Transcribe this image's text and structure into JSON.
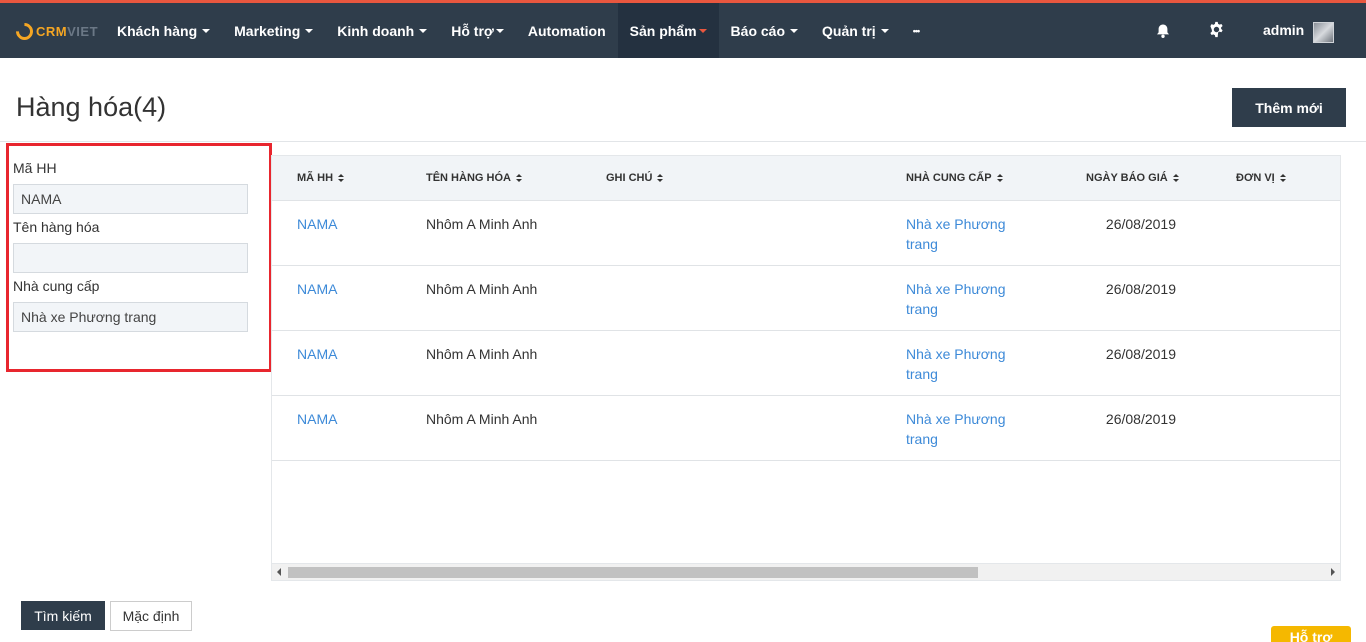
{
  "app": {
    "logo_primary": "CRM",
    "logo_secondary": "VIET",
    "accent": "#e9573f",
    "navbar_bg": "#2f3d4b"
  },
  "nav": {
    "items": [
      {
        "label": "Khách hàng",
        "dropdown": true
      },
      {
        "label": "Marketing",
        "dropdown": true
      },
      {
        "label": "Kinh doanh",
        "dropdown": true
      },
      {
        "label": "Hỗ trợ",
        "dropdown": true
      },
      {
        "label": "Automation",
        "dropdown": false
      },
      {
        "label": "Sản phẩm",
        "dropdown": true,
        "active": true
      },
      {
        "label": "Báo cáo",
        "dropdown": true
      },
      {
        "label": "Quản trị",
        "dropdown": true
      },
      {
        "label": "•••",
        "dropdown": false
      }
    ],
    "user": "admin"
  },
  "page": {
    "title": "Hàng hóa(4)",
    "add_button": "Thêm mới"
  },
  "filters": {
    "code_label": "Mã HH",
    "code_value": "NAMA",
    "name_label": "Tên hàng hóa",
    "name_value": "",
    "supplier_label": "Nhà cung cấp",
    "supplier_value": "Nhà xe Phương trang"
  },
  "table": {
    "columns": [
      "MÃ HH",
      "TÊN HÀNG HÓA",
      "GHI CHÚ",
      "NHÀ CUNG CẤP",
      "NGÀY BÁO GIÁ",
      "ĐƠN VỊ"
    ],
    "rows": [
      {
        "code": "NAMA",
        "name": "Nhôm A Minh Anh",
        "note": "",
        "supplier_line1": "Nhà xe Phương",
        "supplier_line2": "trang",
        "date": "26/08/2019",
        "unit": ""
      },
      {
        "code": "NAMA",
        "name": "Nhôm A Minh Anh",
        "note": "",
        "supplier_line1": "Nhà xe Phương",
        "supplier_line2": "trang",
        "date": "26/08/2019",
        "unit": ""
      },
      {
        "code": "NAMA",
        "name": "Nhôm A Minh Anh",
        "note": "",
        "supplier_line1": "Nhà xe Phương",
        "supplier_line2": "trang",
        "date": "26/08/2019",
        "unit": ""
      },
      {
        "code": "NAMA",
        "name": "Nhôm A Minh Anh",
        "note": "",
        "supplier_line1": "Nhà xe Phương",
        "supplier_line2": "trang",
        "date": "26/08/2019",
        "unit": ""
      }
    ]
  },
  "actions": {
    "search": "Tìm kiếm",
    "default": "Mặc định",
    "help": "Hỗ trợ"
  }
}
